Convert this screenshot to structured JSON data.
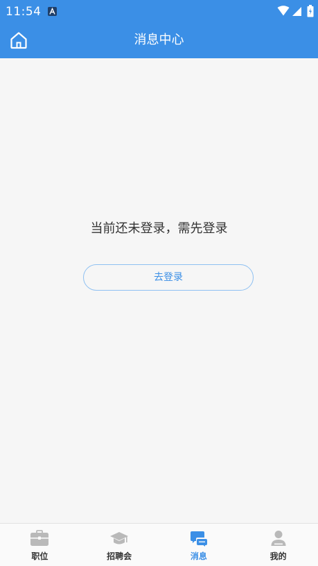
{
  "status_bar": {
    "time": "11:54",
    "notification_icon": "a-badge-icon",
    "wifi_icon": "wifi-icon",
    "signal_icon": "signal-icon",
    "battery_icon": "battery-icon"
  },
  "header": {
    "title": "消息中心",
    "home_icon": "home-icon"
  },
  "main": {
    "prompt": "当前还未登录，需先登录",
    "login_button_label": "去登录"
  },
  "tab_bar": {
    "tabs": [
      {
        "label": "职位",
        "icon": "briefcase-icon",
        "active": false
      },
      {
        "label": "招聘会",
        "icon": "graduation-cap-icon",
        "active": false
      },
      {
        "label": "消息",
        "icon": "message-icon",
        "active": true
      },
      {
        "label": "我的",
        "icon": "user-icon",
        "active": false
      }
    ]
  },
  "colors": {
    "primary": "#3b8fe6",
    "background": "#f6f6f6",
    "text": "#333333",
    "inactive_icon": "#b9b9b9"
  }
}
